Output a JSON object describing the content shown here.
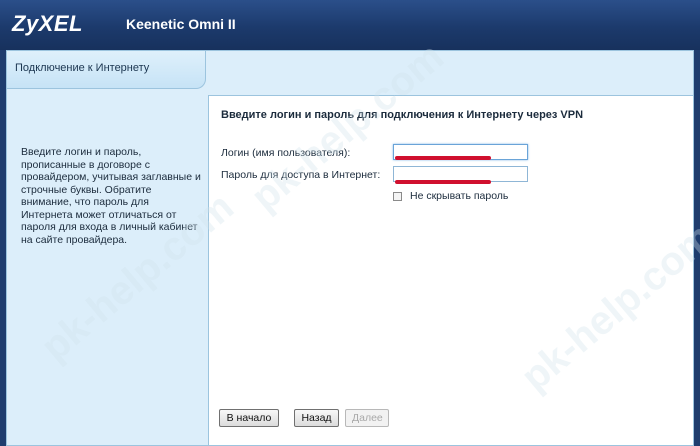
{
  "header": {
    "brand": "ZyXEL",
    "model": "Keenetic Omni II"
  },
  "sidebar": {
    "title": "Подключение к Интернету",
    "help": "Введите логин и пароль, прописанные в договоре с провайдером, учитывая заглавные и строчные буквы. Обратите внимание, что пароль для Интернета может отличаться от пароля для входа в личный кабинет на сайте провайдера."
  },
  "form": {
    "heading": "Введите логин и пароль для подключения к Интернету через VPN",
    "login_label": "Логин (имя пользователя):",
    "login_value": "",
    "password_label": "Пароль для доступа в Интернет:",
    "password_value": "",
    "show_password_label": "Не скрывать пароль",
    "show_password_checked": false
  },
  "buttons": {
    "start": "В начало",
    "back": "Назад",
    "next": "Далее"
  },
  "watermark": "pk-help.com",
  "colors": {
    "header": "#1c3a6c",
    "panel": "#dceefa",
    "redaction": "#d0102e"
  }
}
